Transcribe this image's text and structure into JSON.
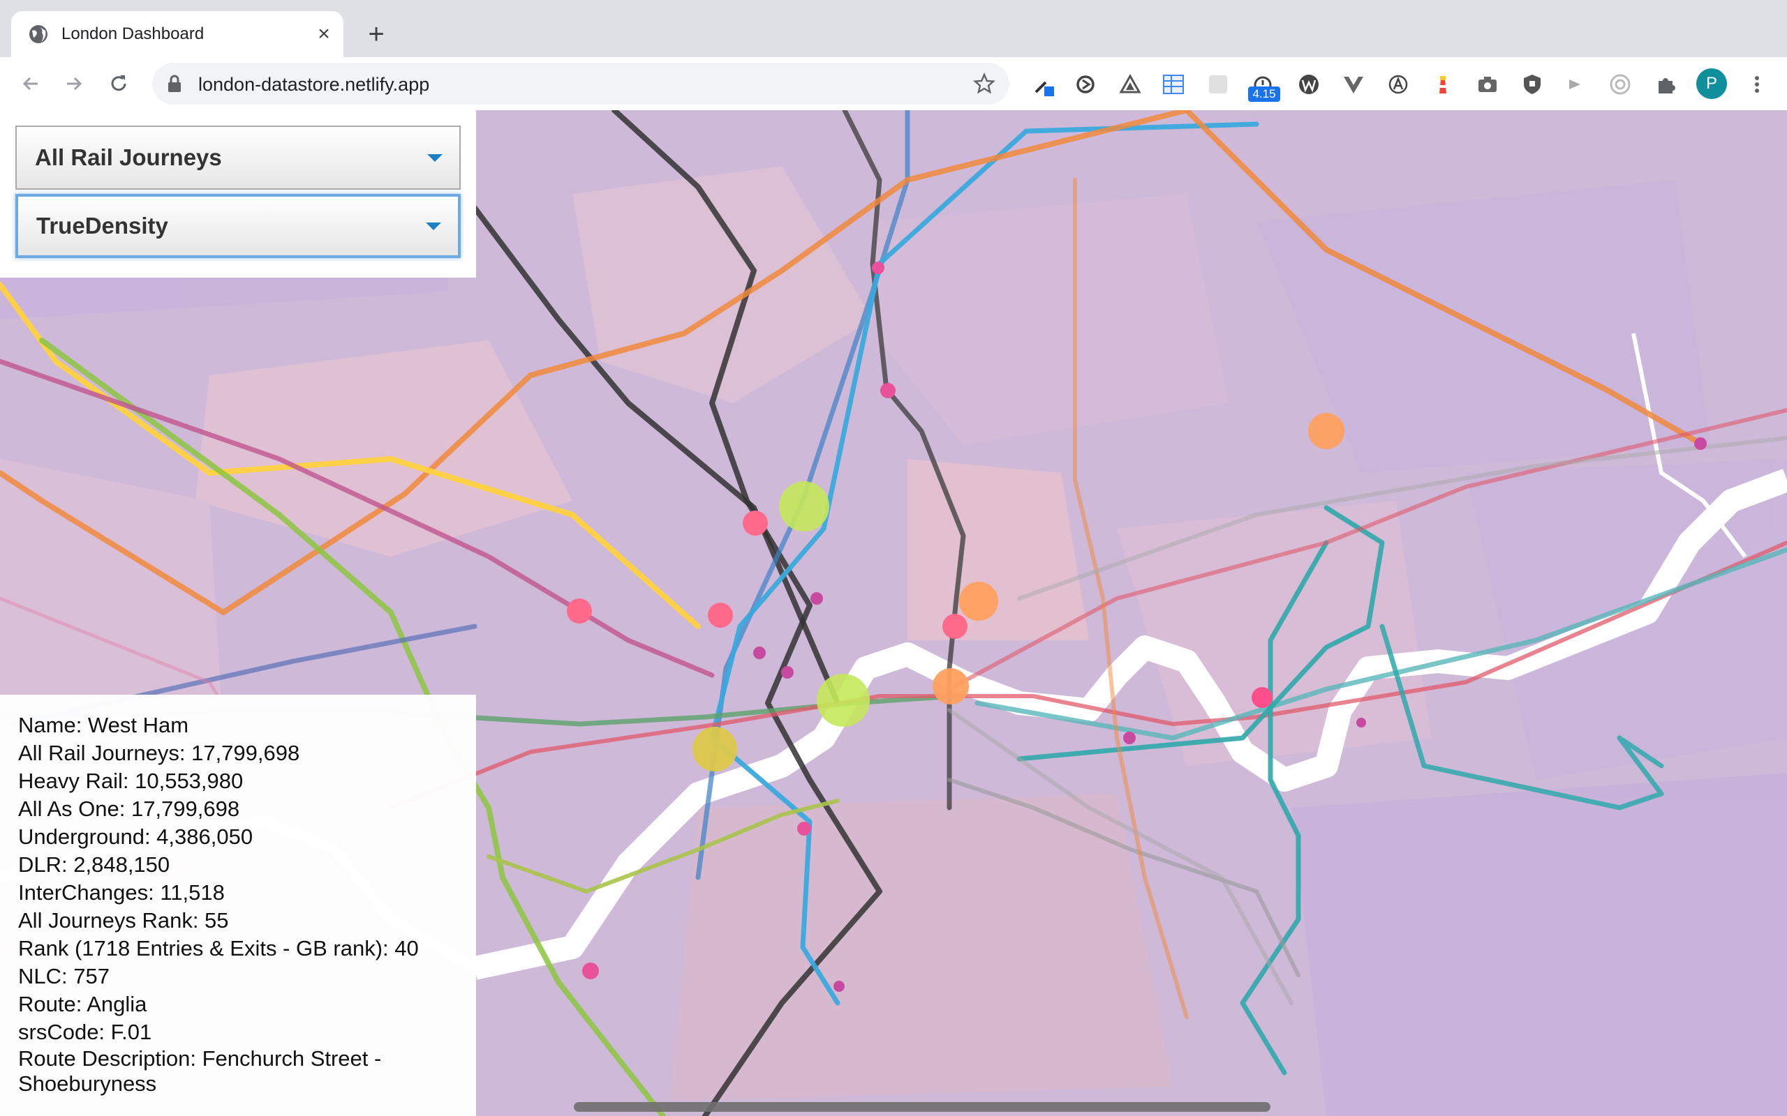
{
  "browser": {
    "tab_title": "London Dashboard",
    "tab_close": "×",
    "new_tab": "+",
    "url": "london-datastore.netlify.app",
    "extension_badge": "4.15",
    "profile_initial": "P",
    "icons": [
      "back-icon",
      "forward-icon",
      "reload-icon",
      "lock-icon",
      "star-icon",
      "eyedropper-icon",
      "sync-icon",
      "triangle-icon",
      "spreadsheet-icon",
      "blank-icon",
      "timer-icon",
      "wordpress-icon",
      "vue-icon",
      "a-circle-icon",
      "lighthouse-icon",
      "camera-icon",
      "shield-icon",
      "arrow-icon",
      "target-icon",
      "puzzle-icon",
      "menu-icon"
    ]
  },
  "controls": {
    "metric_select": "All Rail Journeys",
    "style_select": "TrueDensity"
  },
  "info": {
    "name": "Name: West Ham",
    "all_rail": "All Rail Journeys: 17,799,698",
    "heavy_rail": "Heavy Rail: 10,553,980",
    "all_as_one": "All As One: 17,799,698",
    "underground": "Underground: 4,386,050",
    "dlr": "DLR: 2,848,150",
    "interchanges": "InterChanges: 11,518",
    "rank": "All Journeys Rank: 55",
    "gb_rank": "Rank (1718 Entries & Exits - GB rank): 40",
    "nlc": "NLC: 757",
    "route": "Route: Anglia",
    "srs": "srsCode: F.01",
    "route_desc": "Route Description: Fenchurch Street - Shoeburyness"
  },
  "colors": {
    "map_bg": "#cfb9d9",
    "river": "#ffffff",
    "accent": "#1a73e8"
  }
}
